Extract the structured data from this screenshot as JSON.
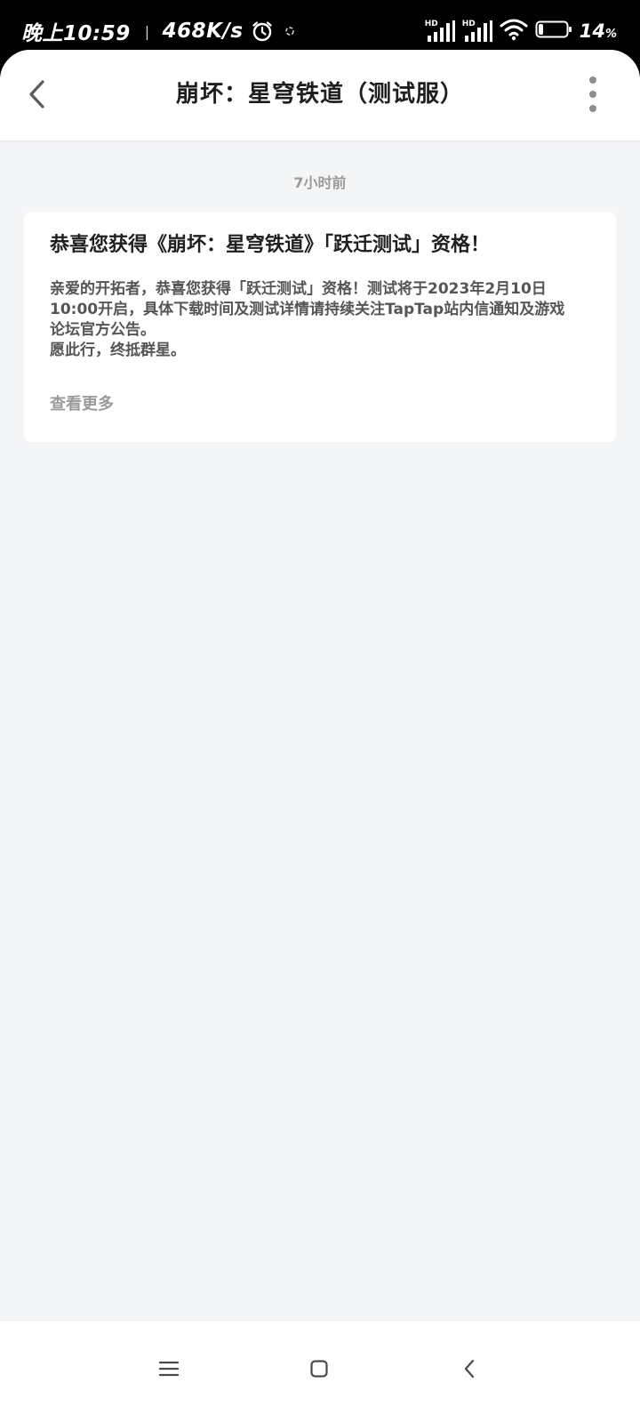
{
  "status_bar": {
    "time": "晚上10:59",
    "network_speed": "468K/s",
    "battery_percent": "14",
    "battery_symbol": "%",
    "signal_1_label": "HD",
    "signal_2_label": "HD",
    "battery_level": 0.14,
    "icons": [
      "alarm-icon",
      "sync-icon",
      "signal-icon",
      "signal-icon",
      "wifi-icon",
      "battery-icon"
    ]
  },
  "header": {
    "title": "崩坏：星穹铁道（测试服）",
    "back_icon": "chevron-left-icon",
    "more_icon": "more-vertical-icon"
  },
  "message": {
    "timestamp": "7小时前",
    "title": "恭喜您获得《崩坏：星穹铁道》「跃迁测试」资格！",
    "body_lines": [
      "亲爱的开拓者，恭喜您获得「跃迁测试」资格！测试将于2023年2月10日 10:00开启，具体下载时间及测试详情请持续关注TapTap站内信通知及游戏论坛官方公告。",
      "愿此行，终抵群星。"
    ],
    "see_more": "查看更多"
  },
  "nav_bar": {
    "icons": [
      "menu-icon",
      "home-icon",
      "back-icon"
    ]
  },
  "colors": {
    "status_bar_bg": "#000000",
    "page_bg": "#f4f5f7",
    "card_bg": "#ffffff",
    "title_text": "#1f1f1f",
    "body_text": "#555555",
    "muted_text": "#9a9a9a"
  }
}
